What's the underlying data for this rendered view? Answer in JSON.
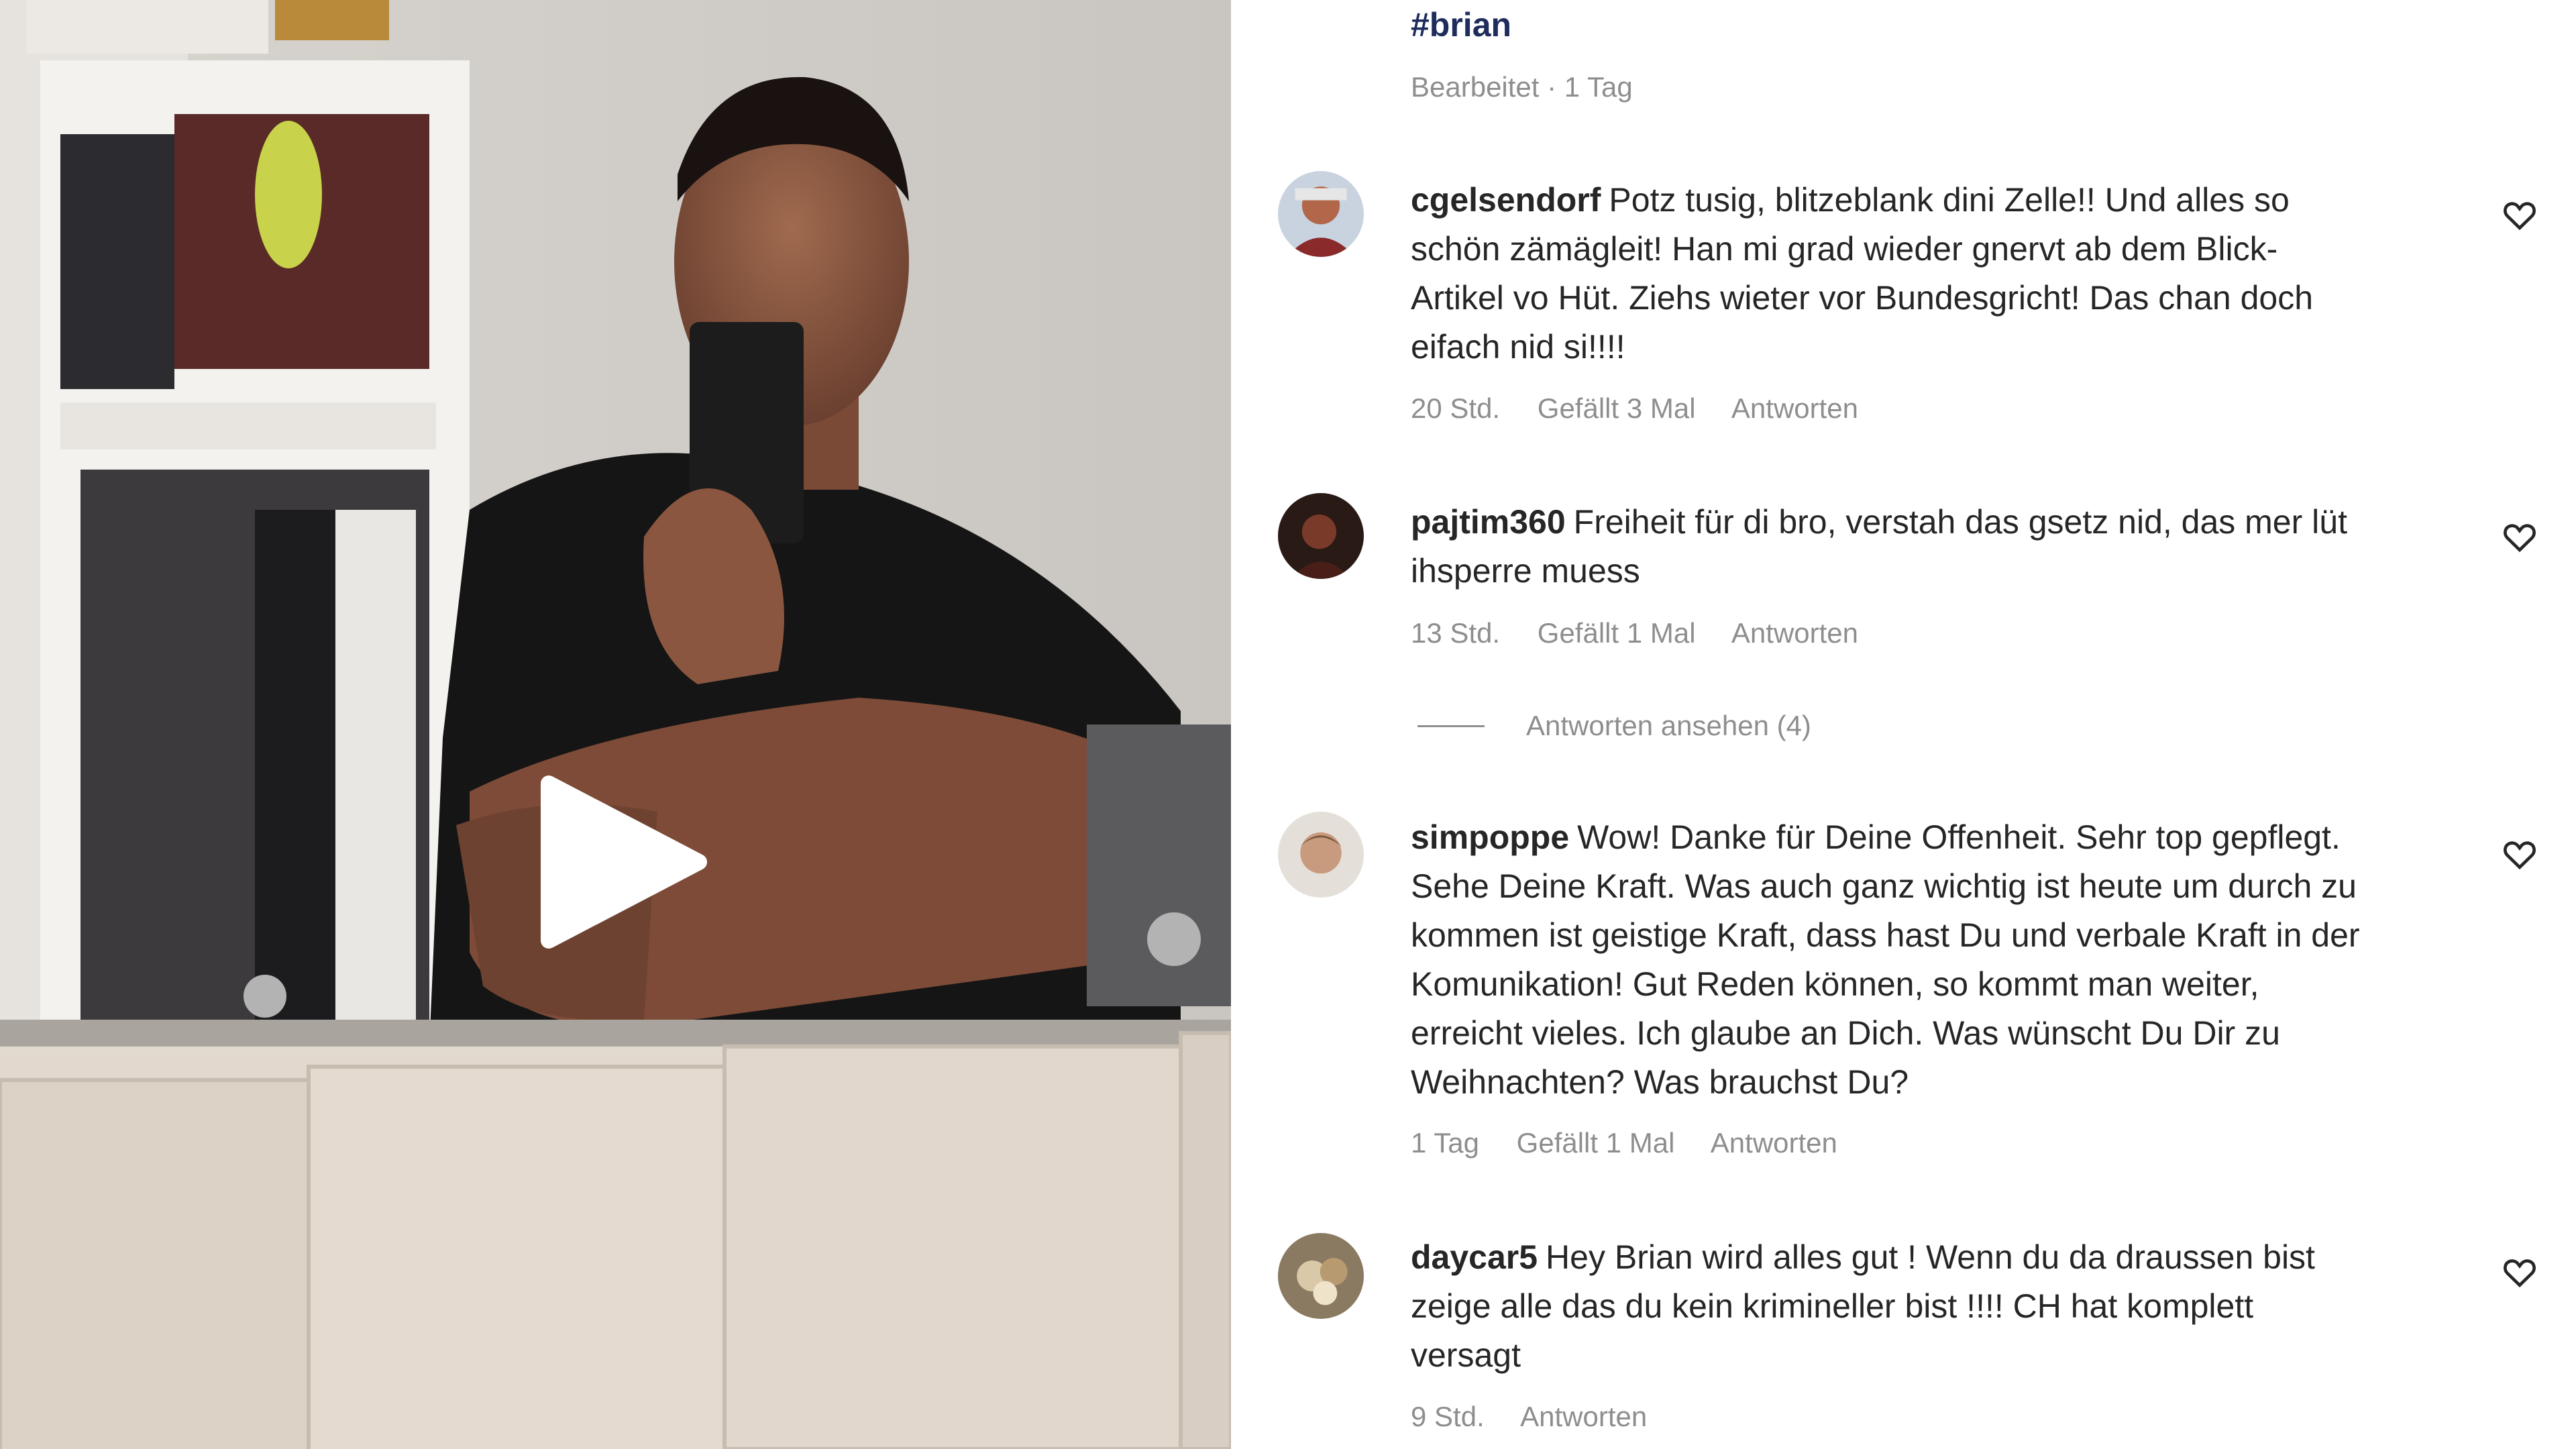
{
  "post": {
    "caption_tail": "#brian",
    "caption_meta": "Bearbeitet · 1 Tag"
  },
  "video": {
    "play_icon": "play-icon",
    "has_play_overlay": true
  },
  "comments": [
    {
      "username": "cgelsendorf",
      "text": "Potz tusig, blitzeblank dini Zelle!! Und alles so schön zämägleit! Han mi grad wieder gnervt ab dem Blick-Artikel vo Hüt. Ziehs wieter vor Bundesgricht! Das chan doch eifach nid si!!!!",
      "time": "20 Std.",
      "likes": "Gefällt 3 Mal",
      "reply": "Antworten"
    },
    {
      "username": "pajtim360",
      "text": "Freiheit für di bro, verstah das gsetz nid, das mer lüt ihsperre muess",
      "time": "13 Std.",
      "likes": "Gefällt 1 Mal",
      "reply": "Antworten"
    },
    {
      "username": "simpoppe",
      "text": "Wow! Danke für Deine Offenheit. Sehr top gepflegt. Sehe Deine Kraft. Was auch ganz wichtig ist heute um durch zu kommen ist geistige Kraft, dass hast Du und verbale Kraft in der Komunikation! Gut Reden können, so kommt man weiter, erreicht vieles. Ich glaube an Dich. Was wünscht Du Dir zu Weihnachten? Was brauchst Du?",
      "time": "1 Tag",
      "likes": "Gefällt 1 Mal",
      "reply": "Antworten"
    },
    {
      "username": "daycar5",
      "text": "Hey Brian wird alles gut ! Wenn du da draussen bist zeige alle das du kein krimineller bist !!!! CH hat komplett versagt",
      "time": "9 Std.",
      "likes": "",
      "reply": "Antworten"
    }
  ],
  "view_replies": "Antworten ansehen (4)",
  "icons": {
    "like": "heart-icon"
  },
  "colors": {
    "username": "#262626",
    "meta": "#8e8e8e",
    "hashtag": "#1f2d5c"
  }
}
